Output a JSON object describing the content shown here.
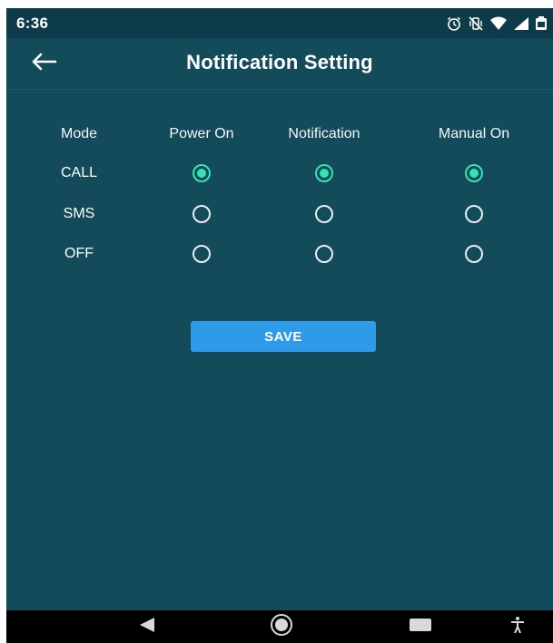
{
  "status_bar": {
    "time": "6:36",
    "icons": [
      "alarm-icon",
      "vibrate-off-icon",
      "wifi-icon",
      "signal-icon",
      "battery-icon"
    ]
  },
  "app_bar": {
    "title": "Notification Setting",
    "back_icon": "arrow-left-icon"
  },
  "table": {
    "headers": [
      "Mode",
      "Power On",
      "Notification",
      "Manual On"
    ],
    "rows": [
      {
        "label": "CALL",
        "values": [
          true,
          true,
          true
        ]
      },
      {
        "label": "SMS",
        "values": [
          false,
          false,
          false
        ]
      },
      {
        "label": "OFF",
        "values": [
          false,
          false,
          false
        ]
      }
    ]
  },
  "save_button": {
    "label": "SAVE"
  },
  "nav_bar": {
    "items": [
      "back-triangle-icon",
      "home-circle-icon",
      "recents-square-icon",
      "accessibility-icon"
    ]
  },
  "colors": {
    "background": "#134b5b",
    "status_bar": "#0d3b49",
    "accent_radio": "#37e3b2",
    "save_button": "#2f9be8"
  }
}
